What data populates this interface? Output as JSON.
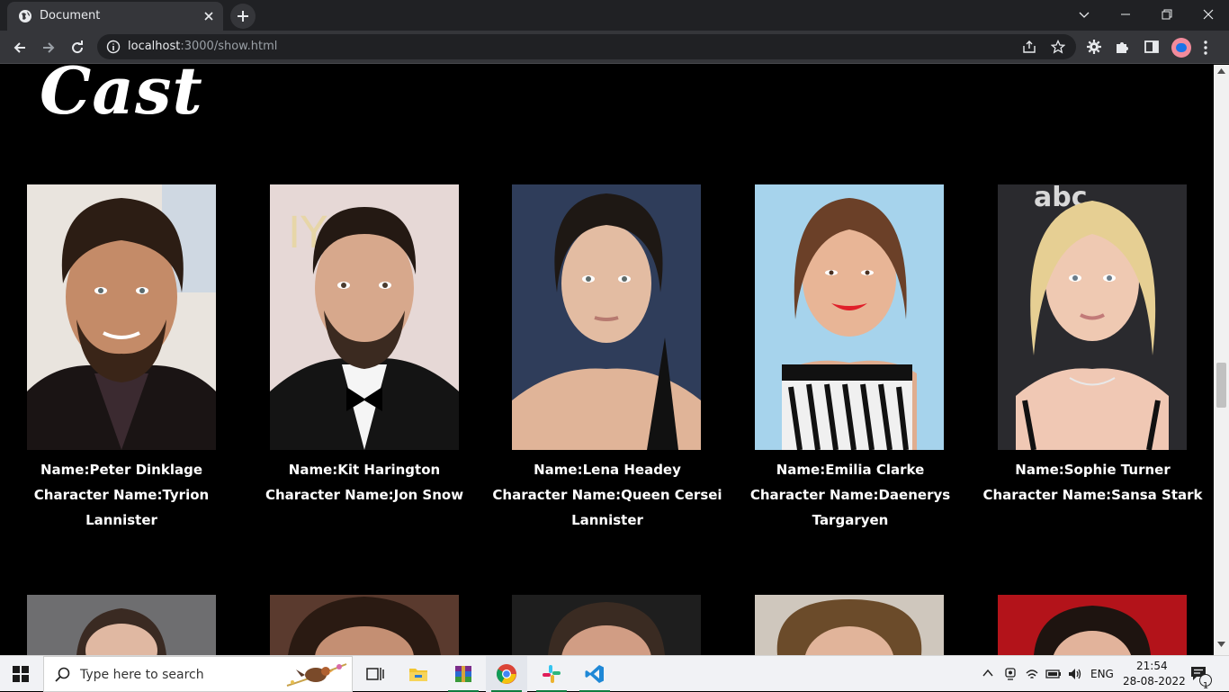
{
  "browser": {
    "tab_title": "Document",
    "url_host": "localhost",
    "url_path": ":3000/show.html"
  },
  "page": {
    "heading": "Cast",
    "cast": [
      {
        "name": "Name:Peter Dinklage",
        "character": "Character Name:Tyrion Lannister",
        "photo_tone": "#7a5b45"
      },
      {
        "name": "Name:Kit Harington",
        "character": "Character Name:Jon Snow",
        "photo_tone": "#d9c9c4"
      },
      {
        "name": "Name:Lena Headey",
        "character": "Character Name:Queen Cersei Lannister",
        "photo_tone": "#2f3d5a"
      },
      {
        "name": "Name:Emilia Clarke",
        "character": "Character Name:Daenerys Targaryen",
        "photo_tone": "#a6d3ec"
      },
      {
        "name": "Name:Sophie Turner",
        "character": "Character Name:Sansa Stark",
        "photo_tone": "#2a2a2e"
      }
    ],
    "second_row_tones": [
      "#6e6e70",
      "#5a3a2e",
      "#1e1e1e",
      "#cfc7bd",
      "#b3131a"
    ]
  },
  "taskbar": {
    "search_placeholder": "Type here to search",
    "language": "ENG",
    "time": "21:54",
    "date": "28-08-2022",
    "notification_count": "1"
  }
}
